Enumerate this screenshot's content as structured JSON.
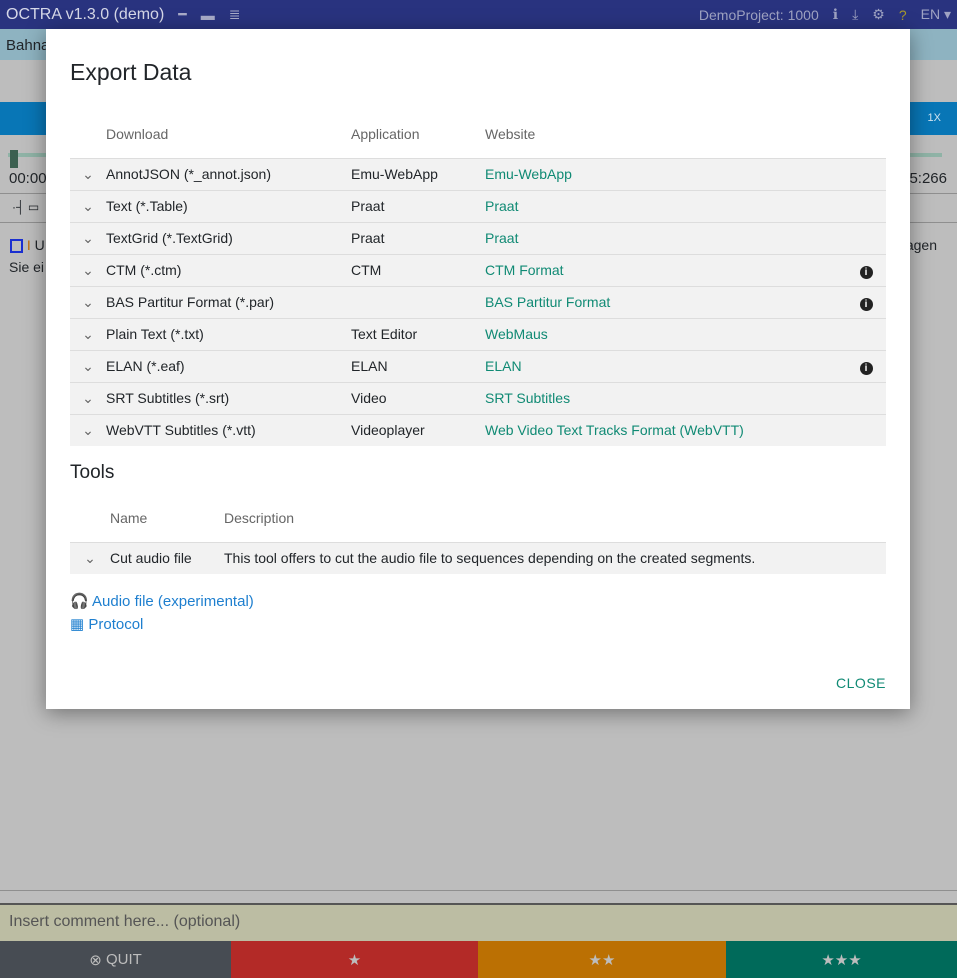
{
  "topbar": {
    "title": "OCTRA v1.3.0 (demo)",
    "project": "DemoProject: 1000",
    "language": "EN"
  },
  "background": {
    "bar_text": "Bahna",
    "speed": "1X",
    "time_start": "00:00",
    "time_end": "5:266",
    "text_line1_right": "agen",
    "text_line2": "Sie ei",
    "text_line1": "U"
  },
  "comment": {
    "placeholder": "Insert comment here... (optional)"
  },
  "footer": {
    "quit": "QUIT",
    "colors": {
      "quit": "#474c53",
      "one": "#b32a27",
      "two": "#bb7003",
      "three": "#006a5a"
    }
  },
  "modal": {
    "title": "Export Data",
    "headers": {
      "download": "Download",
      "application": "Application",
      "website": "Website"
    },
    "rows": [
      {
        "download": "AnnotJSON (*_annot.json)",
        "application": "Emu-WebApp",
        "website": "Emu-WebApp",
        "info": false
      },
      {
        "download": "Text (*.Table)",
        "application": "Praat",
        "website": "Praat",
        "info": false
      },
      {
        "download": "TextGrid (*.TextGrid)",
        "application": "Praat",
        "website": "Praat",
        "info": false
      },
      {
        "download": "CTM (*.ctm)",
        "application": "CTM",
        "website": "CTM Format",
        "info": true
      },
      {
        "download": "BAS Partitur Format (*.par)",
        "application": "",
        "website": "BAS Partitur Format",
        "info": true
      },
      {
        "download": "Plain Text (*.txt)",
        "application": "Text Editor",
        "website": "WebMaus",
        "info": false
      },
      {
        "download": "ELAN (*.eaf)",
        "application": "ELAN",
        "website": "ELAN",
        "info": true
      },
      {
        "download": "SRT Subtitles (*.srt)",
        "application": "Video",
        "website": "SRT Subtitles",
        "info": false
      },
      {
        "download": "WebVTT Subtitles (*.vtt)",
        "application": "Videoplayer",
        "website": "Web Video Text Tracks Format (WebVTT)",
        "info": false
      }
    ],
    "tools_title": "Tools",
    "tools_headers": {
      "name": "Name",
      "description": "Description"
    },
    "tools": [
      {
        "name": "Cut audio file",
        "description": "This tool offers to cut the audio file to sequences depending on the created segments."
      }
    ],
    "links": {
      "audio": "Audio file (experimental)",
      "protocol": "Protocol"
    },
    "close": "CLOSE"
  }
}
